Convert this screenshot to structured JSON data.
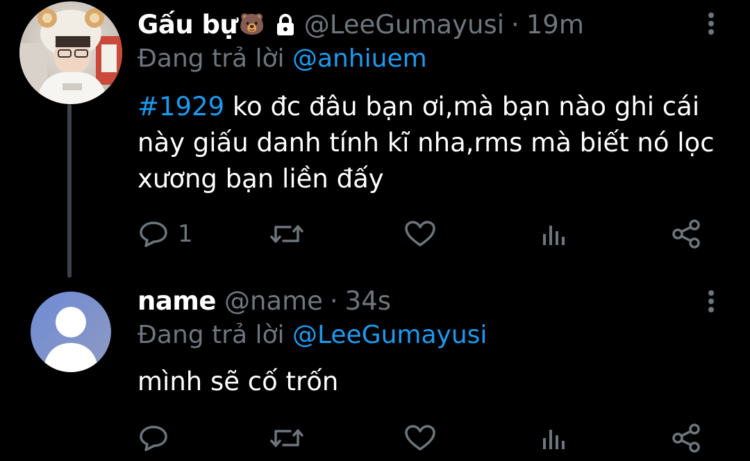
{
  "tweets": [
    {
      "display_name": "Gấu bự",
      "name_emoji": "🐻",
      "handle": "@LeeGumayusi",
      "separator": "·",
      "time": "19m",
      "reply_prefix": "Đang trả lời",
      "reply_to": "@anhiuem",
      "hashtag": "#1929",
      "text": " ko đc đâu bạn ơi,mà bạn nào ghi cái này giấu danh tính kĩ nha,rms mà biết nó lọc xương bạn liền đấy",
      "reply_count": "1",
      "protected": true
    },
    {
      "display_name": "name",
      "handle": "@name",
      "separator": "·",
      "time": "34s",
      "reply_prefix": "Đang trả lời",
      "reply_to": "@LeeGumayusi",
      "text": "mình sẽ cố trốn",
      "reply_count": ""
    }
  ],
  "icons": {
    "reply": "speech-bubble-icon",
    "retweet": "retweet-icon",
    "like": "heart-icon",
    "views": "bar-chart-icon",
    "share": "share-icon",
    "more": "vertical-ellipsis-icon",
    "lock": "lock-icon"
  },
  "colors": {
    "background": "#000000",
    "text": "#ffffff",
    "muted": "#6e767d",
    "accent": "#1d9bf0",
    "thread_line": "#3d4248",
    "default_avatar_bg": "#7b8fc9"
  }
}
